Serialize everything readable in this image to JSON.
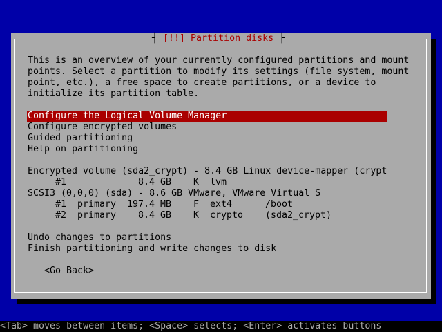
{
  "dialog": {
    "title": "[!!] Partition disks",
    "description_lines": [
      "This is an overview of your currently configured partitions and mount",
      "points. Select a partition to modify its settings (file system, mount",
      "point, etc.), a free space to create partitions, or a device to",
      "initialize its partition table."
    ],
    "menu_items": [
      "Configure the Logical Volume Manager",
      "Configure encrypted volumes",
      "Guided partitioning",
      "Help on partitioning"
    ],
    "devices": [
      {
        "label": "Encrypted volume (sda2_crypt) - 8.4 GB Linux device-mapper (crypt",
        "partitions": [
          {
            "num": "#1",
            "type": "",
            "size": "8.4 GB",
            "flag": "K",
            "fs": "lvm",
            "mount": ""
          }
        ]
      },
      {
        "label": "SCSI3 (0,0,0) (sda) - 8.6 GB VMware, VMware Virtual S",
        "partitions": [
          {
            "num": "#1",
            "type": "primary",
            "size": "197.4 MB",
            "flag": "F",
            "fs": "ext4",
            "mount": "/boot"
          },
          {
            "num": "#2",
            "type": "primary",
            "size": "8.4 GB",
            "flag": "K",
            "fs": "crypto",
            "mount": "(sda2_crypt)"
          }
        ]
      }
    ],
    "actions": [
      "Undo changes to partitions",
      "Finish partitioning and write changes to disk"
    ],
    "go_back_label": "<Go Back>"
  },
  "help_line": "<Tab> moves between items; <Space> selects; <Enter> activates buttons",
  "colors": {
    "background": "#0000a8",
    "dialog": "#aaaaaa",
    "title_text": "#aa0000",
    "selection": "#aa0000",
    "selection_text": "#ffffff"
  }
}
